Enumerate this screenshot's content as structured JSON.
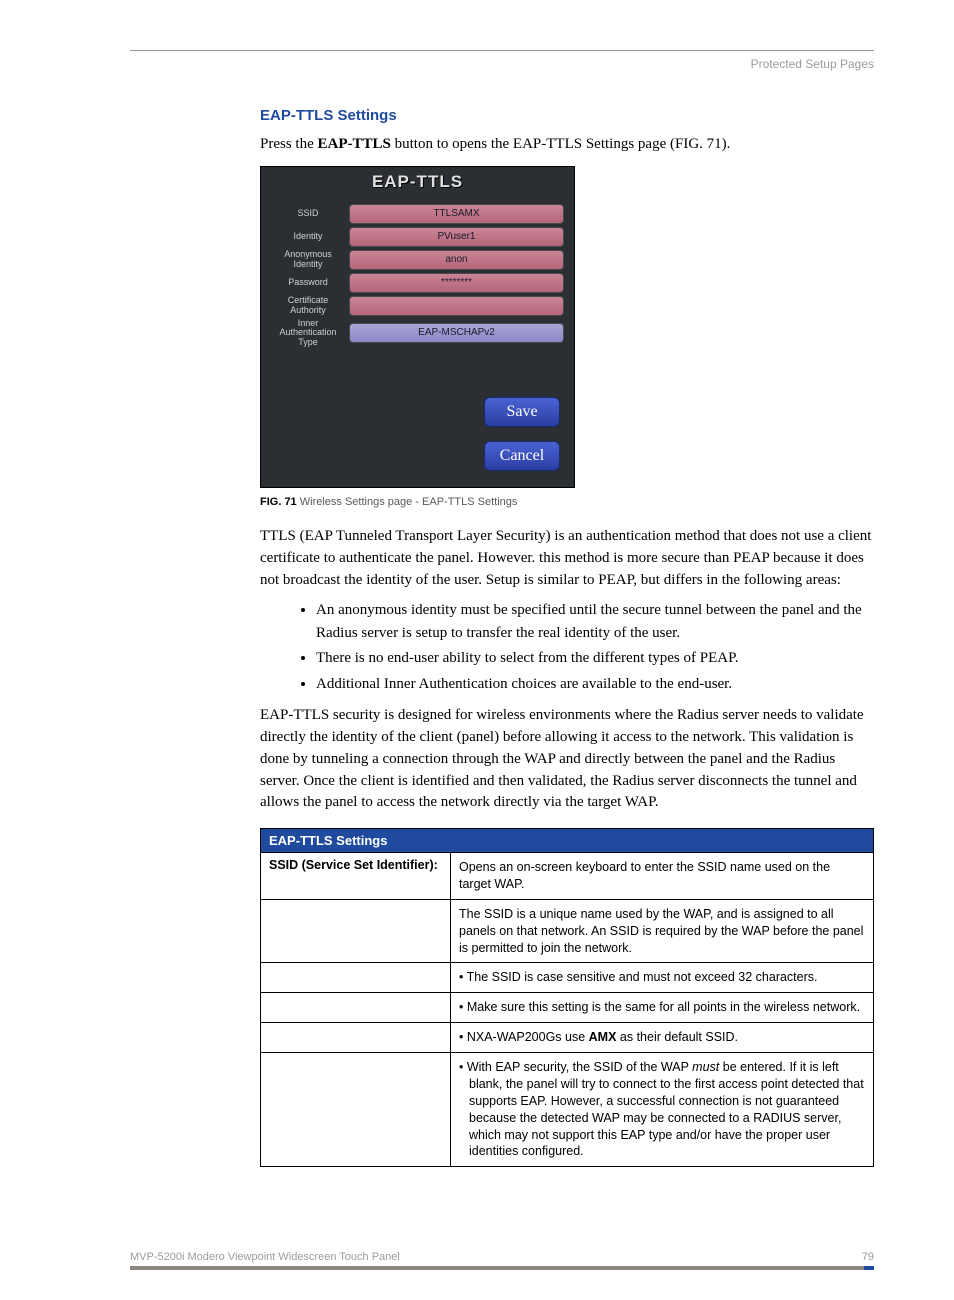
{
  "header": {
    "running": "Protected Setup Pages"
  },
  "section": {
    "title": "EAP-TTLS Settings"
  },
  "intro": {
    "prefix": "Press the ",
    "bold": "EAP-TTLS",
    "suffix": " button to opens the EAP-TTLS Settings page (FIG. 71)."
  },
  "panel": {
    "title": "EAP-TTLS",
    "rows": [
      {
        "label": "SSID",
        "value": "TTLSAMX"
      },
      {
        "label": "Identity",
        "value": "PVuser1"
      },
      {
        "label": "Anonymous Identity",
        "value": "anon"
      },
      {
        "label": "Password",
        "value": "********"
      },
      {
        "label": "Certificate Authority",
        "value": ""
      },
      {
        "label": "Inner Authentication Type",
        "value": "EAP-MSCHAPv2",
        "blue": true
      }
    ],
    "buttons": {
      "save": "Save",
      "cancel": "Cancel"
    }
  },
  "caption": {
    "figref": "FIG. 71",
    "text": "  Wireless Settings page - EAP-TTLS Settings"
  },
  "para1": "TTLS (EAP Tunneled Transport Layer Security) is an authentication method that does not use a client certificate to authenticate the panel. However. this method is more secure than PEAP because it does not broadcast the identity of the user. Setup is similar to PEAP, but differs in the following areas:",
  "bullets": [
    "An anonymous identity must be specified until the secure tunnel between the panel and the Radius server is setup to transfer the real identity of the user.",
    "There is no end-user ability to select from the different types of PEAP.",
    "Additional Inner Authentication choices are available to the end-user."
  ],
  "para2": "EAP-TTLS security is designed for wireless environments where the Radius server needs to validate directly the identity of the client (panel) before allowing it access to the network. This validation is done by tunneling a connection through the WAP and directly between the panel and the Radius server. Once the client is identified and then validated, the Radius server disconnects the tunnel and allows the panel to access the network directly via the target WAP.",
  "table": {
    "header": "EAP-TTLS Settings",
    "rowLabel": "SSID (Service Set Identifier):",
    "cells": {
      "c1": "Opens an on-screen keyboard to enter the SSID name used on the target WAP.",
      "c2": "The SSID is a unique name used by the WAP, and is assigned to all panels on that network. An SSID is required by the WAP before the panel is permitted to join the network.",
      "c3": "• The SSID is case sensitive and must not exceed 32 characters.",
      "c4": "• Make sure this setting is the same for all points in the wireless network.",
      "c5a": "• NXA-WAP200Gs use ",
      "c5b": "AMX",
      "c5c": " as their default SSID.",
      "c6a": "• With EAP security, the SSID of the WAP ",
      "c6b": "must",
      "c6c": " be entered. If it is left blank, the panel will try to connect to the first access point detected that supports EAP. However, a successful connection is not guaranteed because the detected WAP may be connected to a RADIUS server, which may not support this EAP type and/or have the proper user identities configured."
    }
  },
  "footer": {
    "product": "MVP-5200i Modero Viewpoint Widescreen Touch Panel",
    "page": "79"
  }
}
